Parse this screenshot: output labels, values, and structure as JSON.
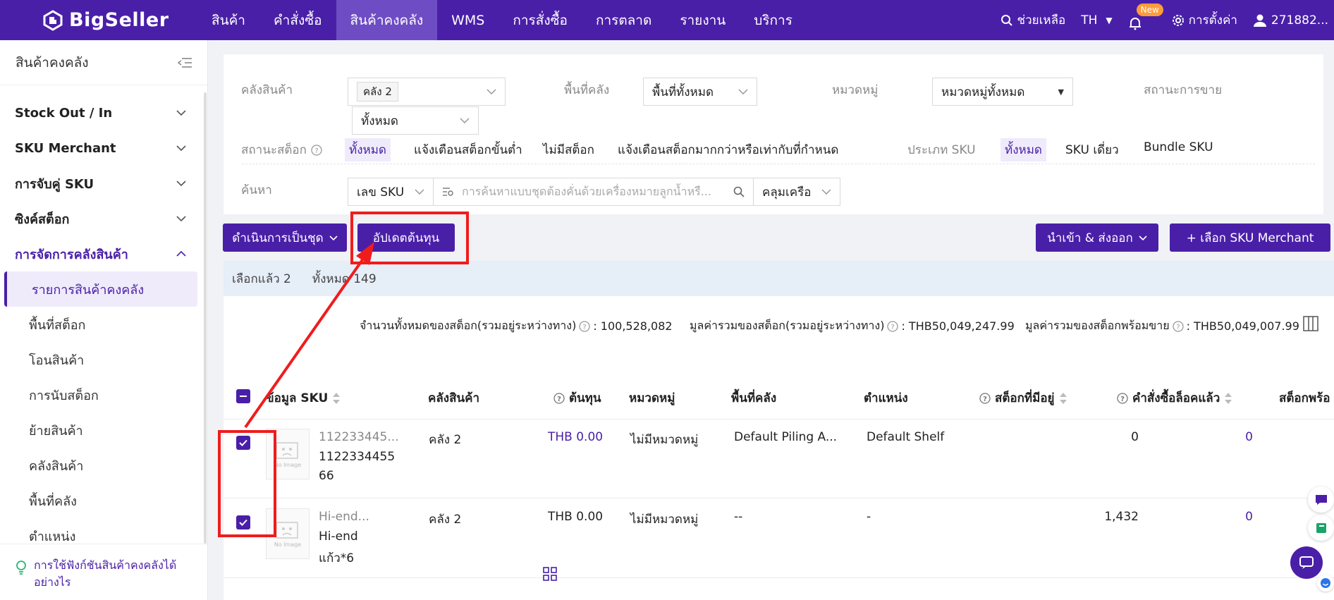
{
  "topbar": {
    "logo": "BigSeller",
    "nav": [
      "สินค้า",
      "คำสั่งซื้อ",
      "สินค้าคงคลัง",
      "WMS",
      "การสั่งซื้อ",
      "การตลาด",
      "รายงาน",
      "บริการ"
    ],
    "help": "ช่วยเหลือ",
    "lang": "TH",
    "new_badge": "New",
    "settings": "การตั้งค่า",
    "user": "271882..."
  },
  "sidebar": {
    "title": "สินค้าคงคลัง",
    "groups": [
      "Stock Out / In",
      "SKU Merchant",
      "การจับคู่ SKU",
      "ซิงค์สต็อก",
      "การจัดการคลังสินค้า"
    ],
    "subitems": [
      "รายการสินค้าคงคลัง",
      "พื้นที่สต็อก",
      "โอนสินค้า",
      "การนับสต็อก",
      "ย้ายสินค้า",
      "คลังสินค้า",
      "พื้นที่คลัง",
      "ตำแหน่ง"
    ],
    "help": "การใช้ฟังก์ชันสินค้าคงคลังได้อย่างไร"
  },
  "filters": {
    "warehouse_label": "คลังสินค้า",
    "warehouse_tag": "คลัง 2",
    "warehouse_all": "ทั้งหมด",
    "area_label": "พื้นที่คลัง",
    "area_value": "พื้นที่ทั้งหมด",
    "category_label": "หมวดหมู่",
    "category_value": "หมวดหมู่ทั้งหมด",
    "sale_status_label": "สถานะการขาย",
    "stock_status_label": "สถานะสต็อก",
    "stock_options": [
      "ทั้งหมด",
      "แจ้งเตือนสต็อกขั้นต่ำ",
      "ไม่มีสต็อก",
      "แจ้งเตือนสต็อกมากกว่าหรือเท่ากับที่กำหนด"
    ],
    "sku_type_label": "ประเภท SKU",
    "sku_type_options": [
      "ทั้งหมด",
      "SKU เดี่ยว",
      "Bundle SKU"
    ],
    "search_label": "ค้นหา",
    "search_field": "เลข SKU",
    "search_placeholder": "การค้นหาแบบชุดต้องคั่นด้วยเครื่องหมายลูกน้ำหรื...",
    "match_mode": "คลุมเครือ"
  },
  "actions": {
    "bulk": "ดำเนินการเป็นชุด",
    "update_cost": "อัปเดตต้นทุน",
    "import_export": "นำเข้า & ส่งออก",
    "select_merchant": "+ เลือก SKU Merchant"
  },
  "selection": {
    "selected": "เลือกแล้ว 2",
    "total": "ทั้งหมด 149"
  },
  "summary": {
    "total_qty_label": "จำนวนทั้งหมดของสต็อก(รวมอยู่ระหว่างทาง)",
    "total_qty": ": 100,528,082",
    "total_value_label": "มูลค่ารวมของสต็อก(รวมอยู่ระหว่างทาง)",
    "total_value": ": THB50,049,247.99",
    "sellable_value_label": "มูลค่ารวมของสต็อกพร้อมขาย",
    "sellable_value": ": THB50,049,007.99"
  },
  "table": {
    "headers": [
      "ข้อมูล SKU",
      "คลังสินค้า",
      "ต้นทุน",
      "หมวดหมู่",
      "พื้นที่คลัง",
      "ตำแหน่ง",
      "สต็อกที่มีอยู่",
      "คำสั่งซื้อล็อคแล้ว",
      "สต็อกพร้อ"
    ],
    "no_image": "No Image",
    "rows": [
      {
        "sku_short": "112233445...",
        "sku_line1": "1122334455",
        "sku_line2": "66",
        "warehouse": "คลัง 2",
        "cost": "THB 0.00",
        "category": "ไม่มีหมวดหมู่",
        "area": "Default Piling A...",
        "location": "Default Shelf",
        "available": "0",
        "locked": "0"
      },
      {
        "sku_short": "Hi-end...",
        "sku_line1": "Hi-end",
        "sku_line2": "แก้ว*6",
        "warehouse": "คลัง 2",
        "cost": "THB 0.00",
        "category": "ไม่มีหมวดหมู่",
        "area": "--",
        "location": "-",
        "available": "1,432",
        "locked": "0"
      }
    ]
  },
  "colors": {
    "brand": "#4a1fa8",
    "highlight": "#f01c1c"
  }
}
